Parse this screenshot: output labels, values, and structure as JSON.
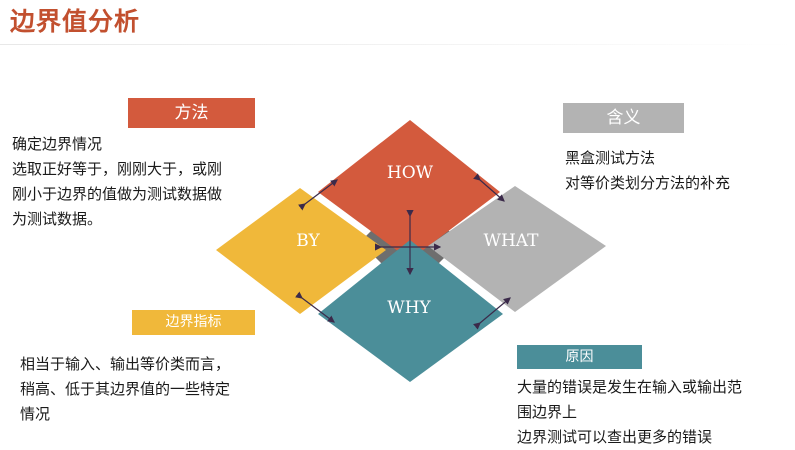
{
  "title": "边界值分析",
  "sections": {
    "method": {
      "label": "方法",
      "lines": [
        "确定边界情况",
        "选取正好等于，刚刚大于，或刚",
        "刚小于边界的值做为测试数据做",
        "为测试数据。"
      ]
    },
    "meaning": {
      "label": "含义",
      "lines": [
        "黑盒测试方法",
        "对等价类划分方法的补充"
      ]
    },
    "indicator": {
      "label": "边界指标",
      "lines": [
        "相当于输入、输出等价类而言，",
        "稍高、低于其边界值的一些特定",
        "情况"
      ]
    },
    "reason": {
      "label": "原因",
      "lines": [
        "大量的错误是发生在输入或输出范",
        "围边界上",
        "边界测试可以查出更多的错误"
      ]
    }
  },
  "diamonds": {
    "how": "HOW",
    "by": "BY",
    "what": "WHAT",
    "why": "WHY"
  },
  "colors": {
    "title": "#c2502f",
    "how": "#d35a3d",
    "by": "#f0b83a",
    "what": "#b3b3b3",
    "why": "#4b8e99",
    "arrow": "#3b2a4a",
    "shadow": "#6e6e6e"
  }
}
